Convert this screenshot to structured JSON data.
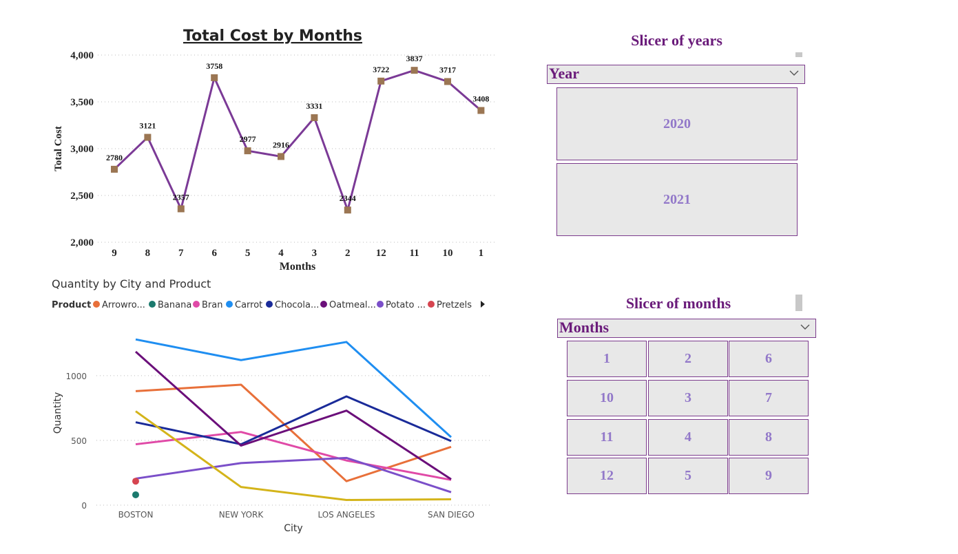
{
  "chart_data": [
    {
      "type": "line",
      "title": "Total Cost by Months",
      "xlabel": "Months",
      "ylabel": "Total Cost",
      "categories": [
        "9",
        "8",
        "7",
        "6",
        "5",
        "4",
        "3",
        "2",
        "12",
        "11",
        "10",
        "1"
      ],
      "values": [
        2780,
        3121,
        2357,
        3758,
        2977,
        2916,
        3331,
        2344,
        3722,
        3837,
        3717,
        3408
      ],
      "ylim": [
        2000,
        4000
      ],
      "yticks": [
        "2,000",
        "2,500",
        "3,000",
        "3,500",
        "4,000"
      ],
      "grid": true,
      "colors": {
        "line": "#7b3a96",
        "marker": "#9b7653"
      }
    },
    {
      "type": "line",
      "title": "Quantity by City and Product",
      "xlabel": "City",
      "ylabel": "Quantity",
      "legend_title": "Product",
      "categories": [
        "BOSTON",
        "NEW YORK",
        "LOS ANGELES",
        "SAN DIEGO"
      ],
      "ylim": [
        0,
        1350
      ],
      "yticks": [
        "0",
        "500",
        "1000"
      ],
      "grid": true,
      "legend_position": "top",
      "series": [
        {
          "name": "Arrowro...",
          "color": "#e8703a",
          "values": [
            880,
            930,
            185,
            450
          ]
        },
        {
          "name": "Banana",
          "color": "#1b7a6e",
          "values": [
            80,
            null,
            null,
            null
          ]
        },
        {
          "name": "Bran",
          "color": "#e04aa7",
          "values": [
            470,
            565,
            345,
            195
          ]
        },
        {
          "name": "Carrot",
          "color": "#1f8ef1",
          "values": [
            1280,
            1120,
            1260,
            525
          ]
        },
        {
          "name": "Chocola...",
          "color": "#1a2b99",
          "values": [
            640,
            470,
            840,
            495
          ]
        },
        {
          "name": "Oatmeal...",
          "color": "#6b0f7a",
          "values": [
            1185,
            460,
            730,
            200
          ]
        },
        {
          "name": "Potato ...",
          "color": "#7b4fc9",
          "values": [
            205,
            325,
            365,
            100
          ]
        },
        {
          "name": "Pretzels",
          "color": "#d64550",
          "values": [
            185,
            null,
            null,
            null
          ]
        },
        {
          "name": "",
          "color": "#d4b41a",
          "values": [
            725,
            140,
            40,
            45
          ]
        }
      ]
    }
  ],
  "slicer_years": {
    "title": "Slicer of years",
    "header": "Year",
    "options": [
      "2020",
      "2021"
    ]
  },
  "slicer_months": {
    "title": "Slicer of months",
    "header": "Months",
    "options": [
      "1",
      "2",
      "6",
      "10",
      "3",
      "7",
      "11",
      "4",
      "8",
      "12",
      "5",
      "9"
    ]
  }
}
